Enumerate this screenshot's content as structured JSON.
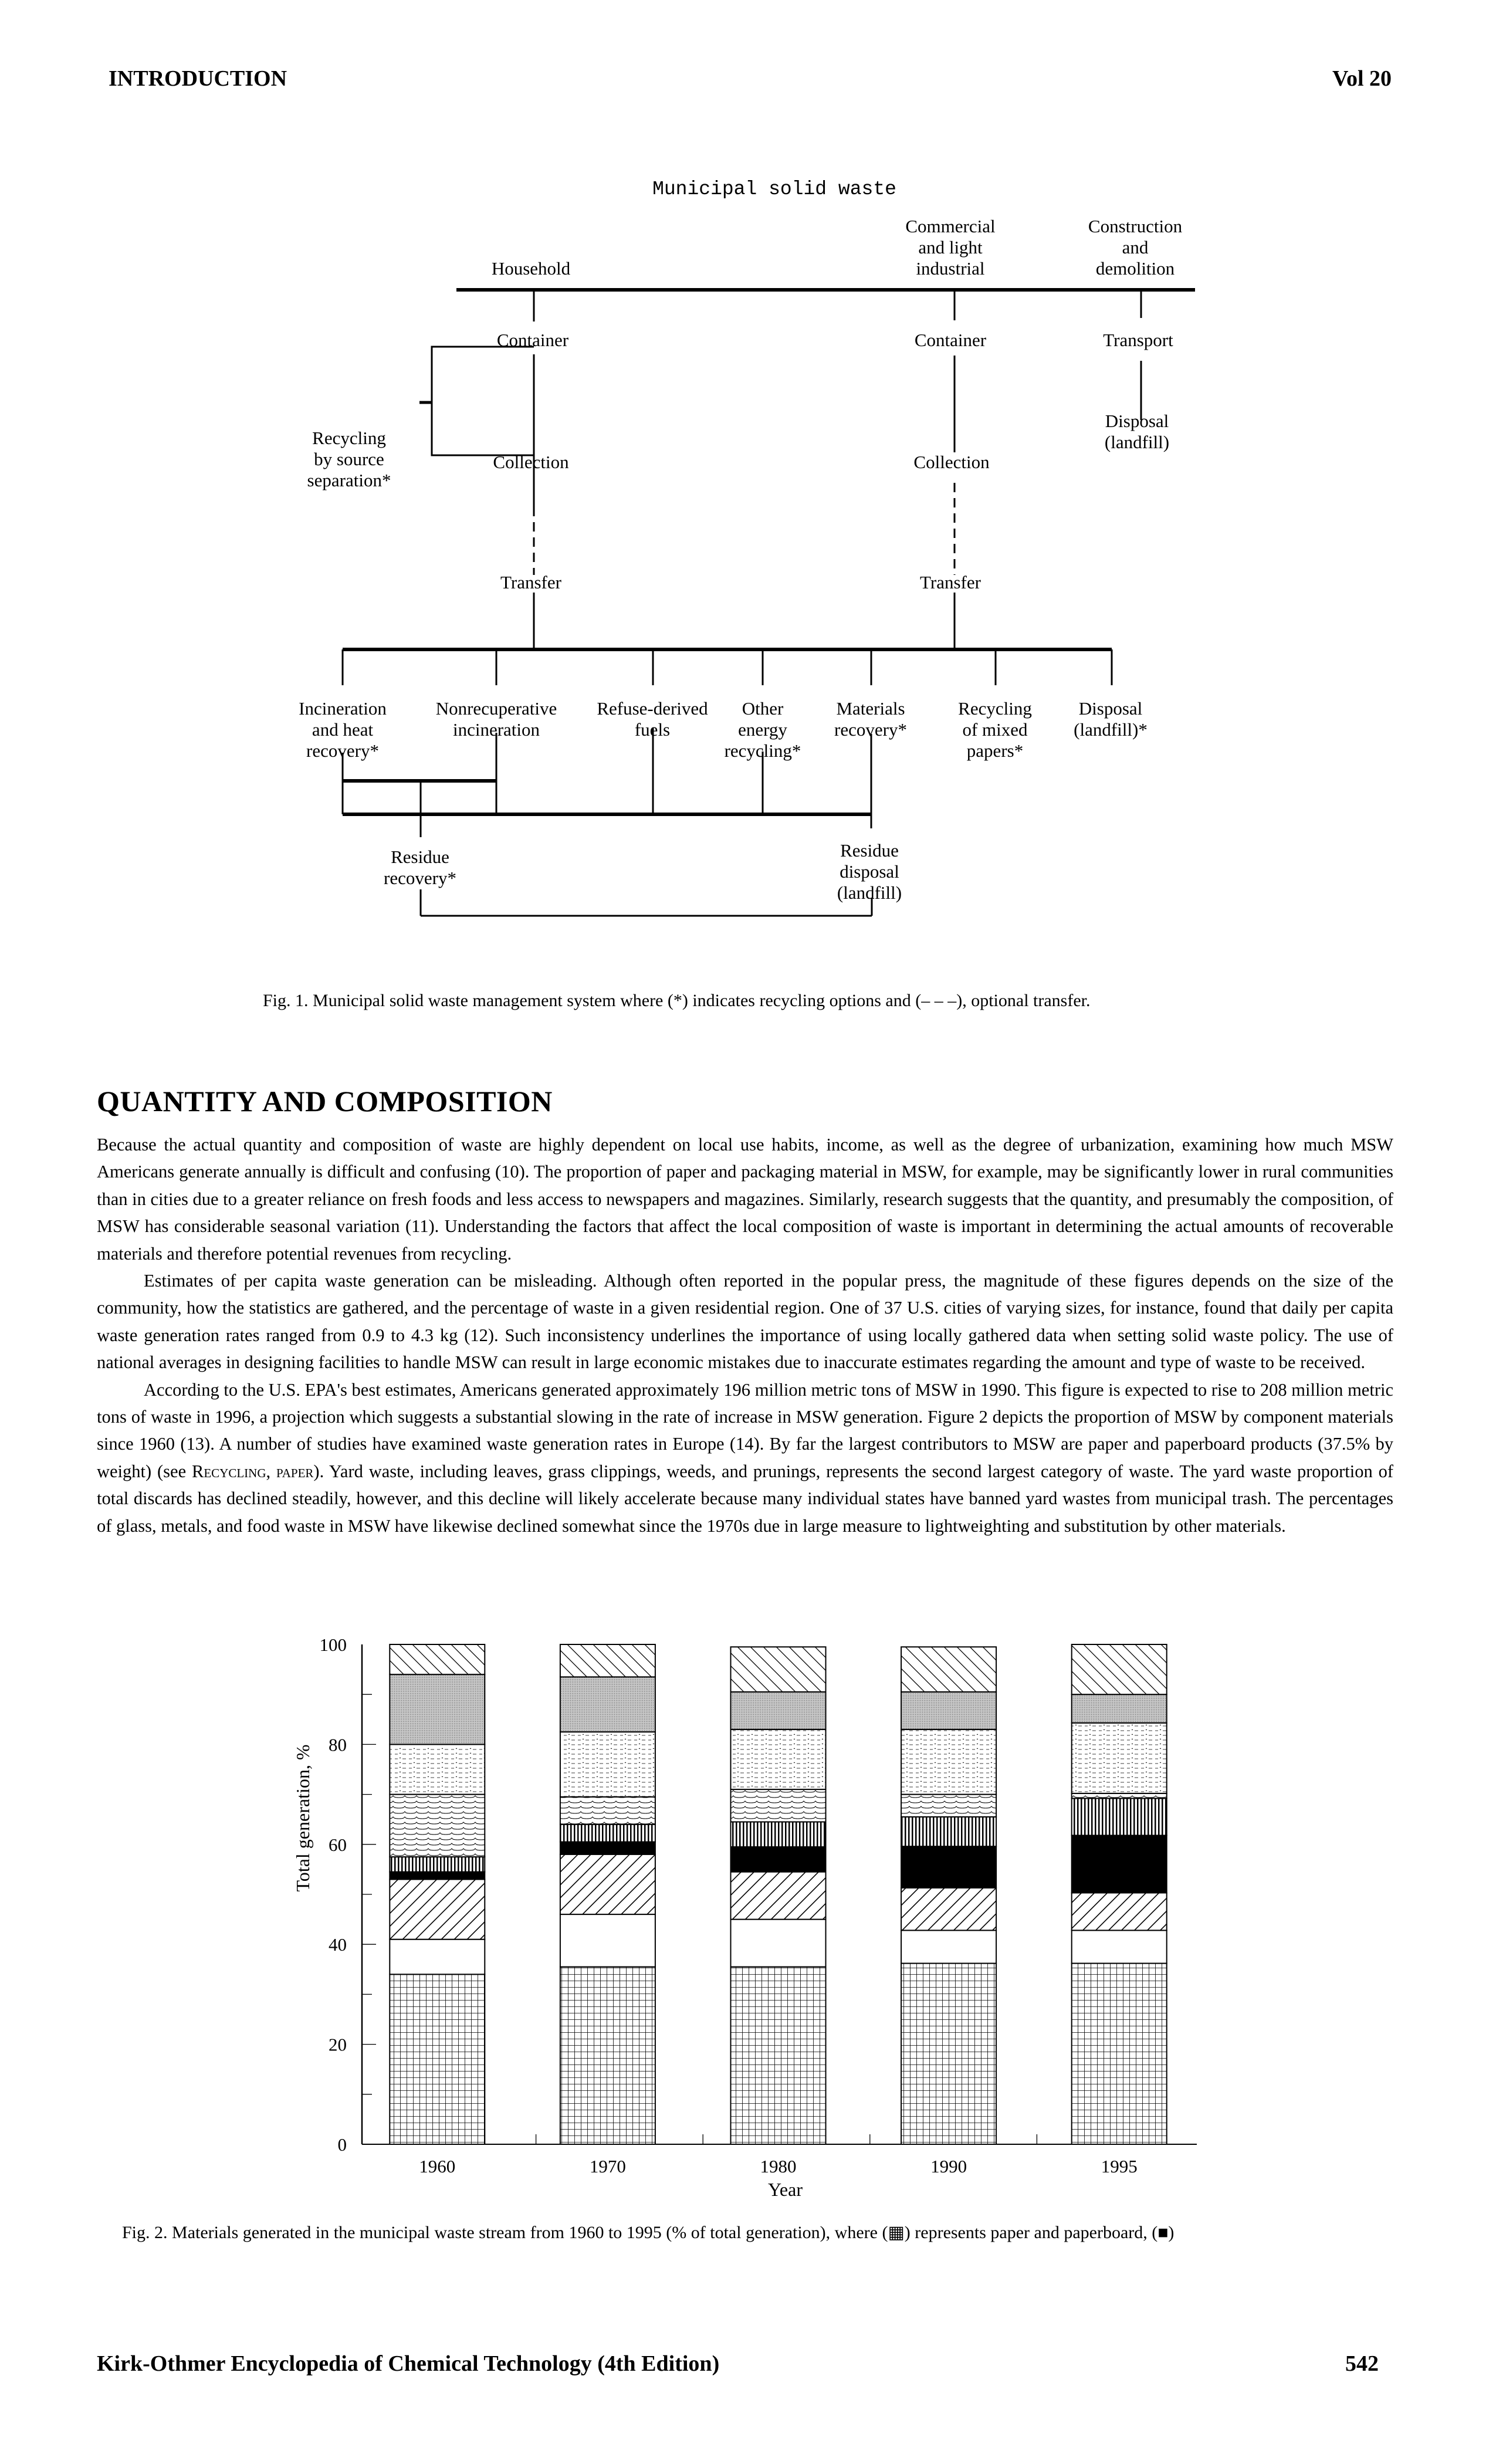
{
  "header": {
    "left": "INTRODUCTION",
    "right": "Vol 20"
  },
  "figure1": {
    "title": "Municipal solid waste",
    "sources": {
      "household": "Household",
      "commercial": "Commercial\nand light\nindustrial",
      "construction": "Construction\nand\ndemolition"
    },
    "nodes": {
      "container_household": "Container",
      "container_commercial": "Container",
      "transport": "Transport",
      "disposal_cd": "Disposal\n(landfill)",
      "recycling_source": "Recycling\nby source\nseparation*",
      "collection_household": "Collection",
      "collection_commercial": "Collection",
      "transfer_household": "Transfer",
      "transfer_commercial": "Transfer",
      "incineration_heat": "Incineration\nand heat\nrecovery*",
      "nonrecuperative": "Nonrecuperative\nincineration",
      "rdf": "Refuse-derived\nfuels",
      "other_energy": "Other\nenergy\nrecycling*",
      "materials_recovery": "Materials\nrecovery*",
      "recycling_mixed": "Recycling\nof mixed\npapers*",
      "disposal_landfill": "Disposal\n(landfill)*",
      "residue_recovery": "Residue\nrecovery*",
      "residue_disposal": "Residue\ndisposal\n(landfill)"
    },
    "caption": "Fig. 1. Municipal solid waste management system where (*) indicates recycling options and (– – –), optional transfer."
  },
  "section": {
    "title": "QUANTITY AND COMPOSITION",
    "paragraphs": [
      "Because the actual quantity and composition of waste are highly dependent on local use habits, income, as well as the degree of urbanization, examining how much MSW Americans generate annually is difficult and confusing (10). The proportion of paper and packaging material in MSW, for example, may be significantly lower in rural communities than in cities due to a greater reliance on fresh foods and less access to newspapers and magazines. Similarly, research suggests that the quantity, and presumably the composition, of MSW has considerable seasonal variation (11). Understanding the factors that affect the local composition of waste is important in determining the actual amounts of recoverable materials and therefore potential revenues from recycling.",
      "Estimates of per capita waste generation can be misleading. Although often reported in the popular press, the magnitude of these figures depends on the size of the community, how the statistics are gathered, and the percentage of waste in a given residential region. One of 37 U.S. cities of varying sizes, for instance, found that daily per capita waste generation rates ranged from 0.9 to 4.3 kg (12). Such inconsistency underlines the importance of using locally gathered data when setting solid waste policy. The use of national averages in designing facilities to handle MSW can result in large economic mistakes due to inaccurate estimates regarding the amount and type of waste to be received."
    ],
    "p3_before": "According to the U.S. EPA's best estimates, Americans generated approximately 196 million metric tons of MSW in 1990. This figure is expected to rise to 208 million metric tons of waste in 1996, a projection which suggests a substantial slowing in the rate of increase in MSW generation. Figure 2 depicts the proportion of MSW by component materials since 1960 (13). A number of studies have examined waste generation rates in Europe (14). By far the largest contributors to MSW are paper and paperboard products (37.5% by weight) (see ",
    "p3_link": "Recycling, paper",
    "p3_after": "). Yard waste, including leaves, grass clippings, weeds, and prunings, represents the second largest category of waste. The yard waste proportion of total discards has declined steadily, however, and this decline will likely accelerate because many individual states have banned yard wastes from municipal trash. The percentages of glass, metals, and food waste in MSW have likewise declined somewhat since the 1970s due in large measure to lightweighting and substitution by other materials."
  },
  "chart_data": {
    "type": "bar",
    "stacked": true,
    "title": "",
    "xlabel": "Year",
    "ylabel": "Total generation, %",
    "ylim": [
      0,
      100
    ],
    "yticks": [
      "0",
      "20",
      "40",
      "60",
      "80",
      "100"
    ],
    "categories": [
      "1960",
      "1970",
      "1980",
      "1990",
      "1995"
    ],
    "series": [
      {
        "name": "paper and paperboard",
        "pattern": "grid",
        "values": [
          34.0,
          35.5,
          35.5,
          36.2,
          36.2
        ]
      },
      {
        "name": "white (unlabeled)",
        "pattern": "blank",
        "values": [
          7.0,
          10.5,
          9.5,
          6.6,
          6.6
        ]
      },
      {
        "name": "forward diagonal (unlabeled)",
        "pattern": "fwd-diag",
        "values": [
          12.0,
          12.0,
          9.5,
          8.5,
          7.5
        ]
      },
      {
        "name": "solid black (unlabeled)",
        "pattern": "solid",
        "values": [
          1.5,
          2.5,
          5.0,
          8.3,
          11.5
        ]
      },
      {
        "name": "vertical lines (unlabeled)",
        "pattern": "vertical",
        "values": [
          3.0,
          3.5,
          5.0,
          5.9,
          7.4
        ]
      },
      {
        "name": "wavy lines (unlabeled)",
        "pattern": "wavy",
        "values": [
          12.5,
          5.5,
          6.5,
          4.5,
          1.0
        ]
      },
      {
        "name": "dashed wavy (unlabeled)",
        "pattern": "dashed",
        "values": [
          10.0,
          13.0,
          12.0,
          13.0,
          14.1
        ]
      },
      {
        "name": "stipple (unlabeled)",
        "pattern": "stipple",
        "values": [
          14.0,
          11.0,
          7.5,
          7.5,
          5.7
        ]
      },
      {
        "name": "back diagonal (unlabeled)",
        "pattern": "back-diag",
        "values": [
          6.0,
          6.5,
          9.0,
          9.0,
          10.0
        ]
      }
    ],
    "legend": "none (patterns described in caption)",
    "grid": false
  },
  "figure2": {
    "caption": "Fig. 2. Materials generated in the municipal waste stream from 1960 to 1995 (% of total generation), where (▦) represents paper and paperboard, (■)"
  },
  "footer": {
    "left": "Kirk-Othmer Encyclopedia of Chemical Technology (4th Edition)",
    "right": "542"
  }
}
